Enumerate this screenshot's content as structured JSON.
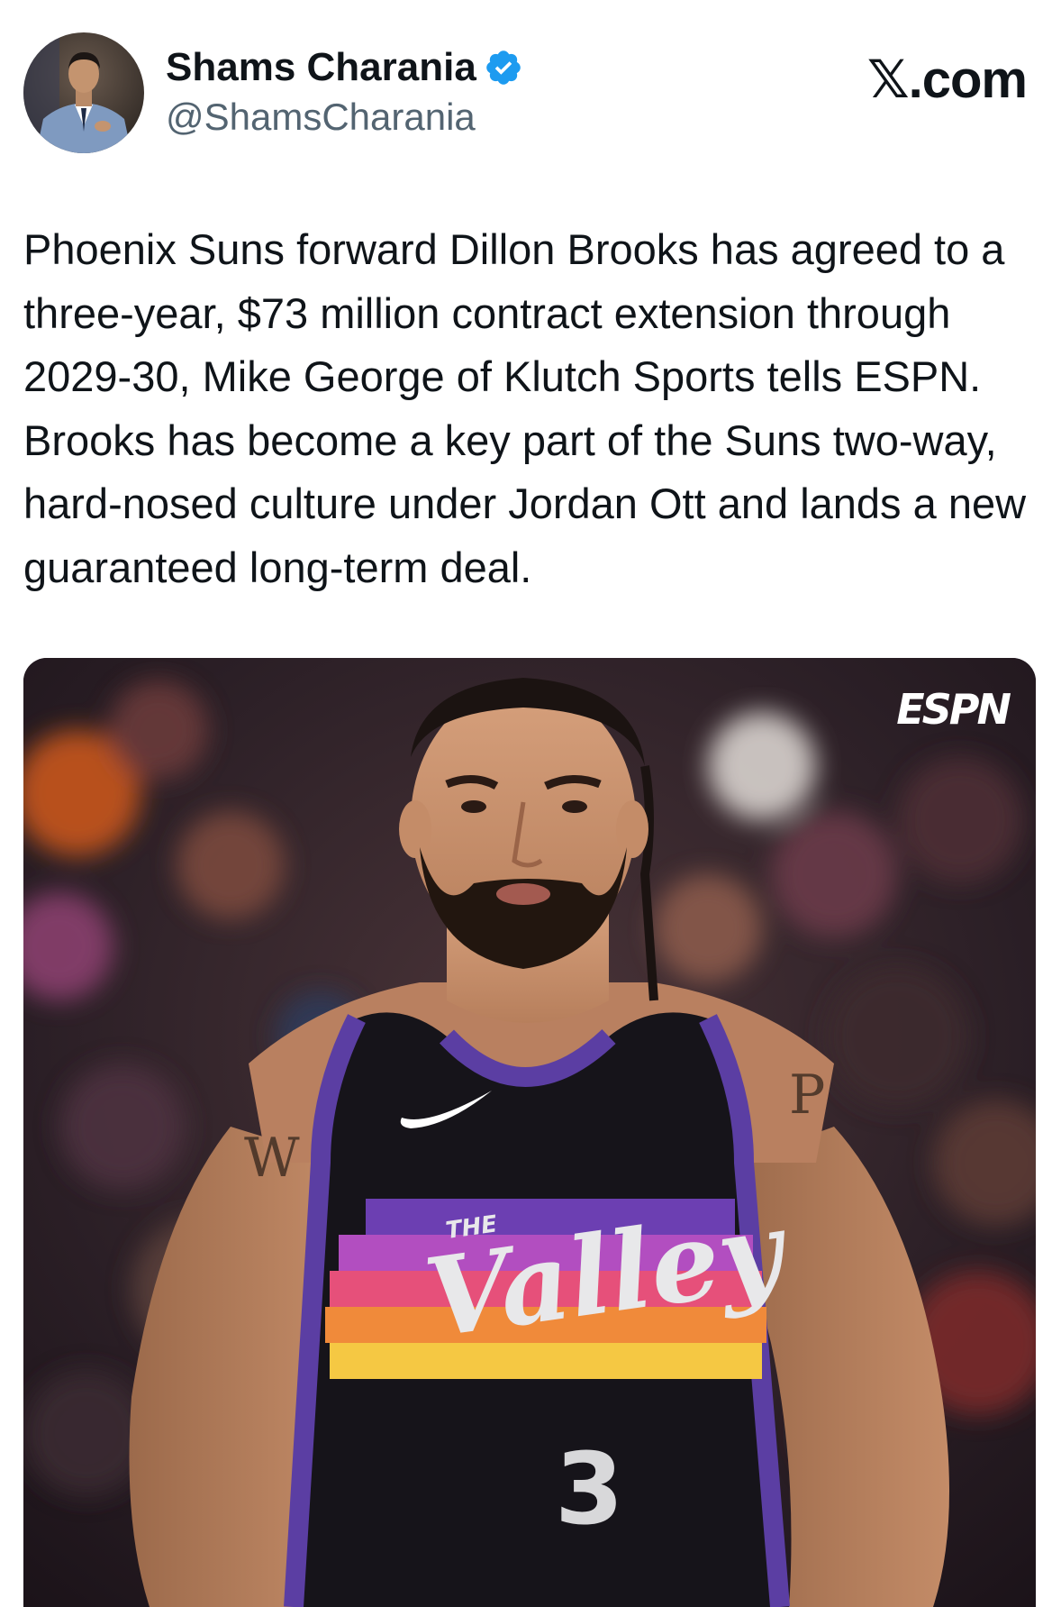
{
  "author": {
    "name": "Shams Charania",
    "handle": "@ShamsCharania",
    "verified": true,
    "avatar_icon": "profile-photo"
  },
  "brand": "𝕏.com",
  "tweet": {
    "text": "Phoenix Suns forward Dillon Brooks has agreed to a three-year, $73 million contract extension through 2029-30, Mike George of Klutch Sports tells ESPN. Brooks has become a key part of the Suns two-way, hard-nosed culture under Jordan Ott and lands a new guaranteed long-term deal."
  },
  "media": {
    "watermark": "ESPN",
    "jersey_wordmark": "Valley",
    "jersey_wordmark_small": "THE",
    "jersey_number": "3",
    "tattoo_left": "W",
    "tattoo_right": "P"
  },
  "colors": {
    "verified_blue": "#1d9bf0",
    "text_primary": "#0f1419",
    "text_secondary": "#536471",
    "jersey_purple": "#5b3ea3",
    "jersey_black": "#16141a"
  }
}
